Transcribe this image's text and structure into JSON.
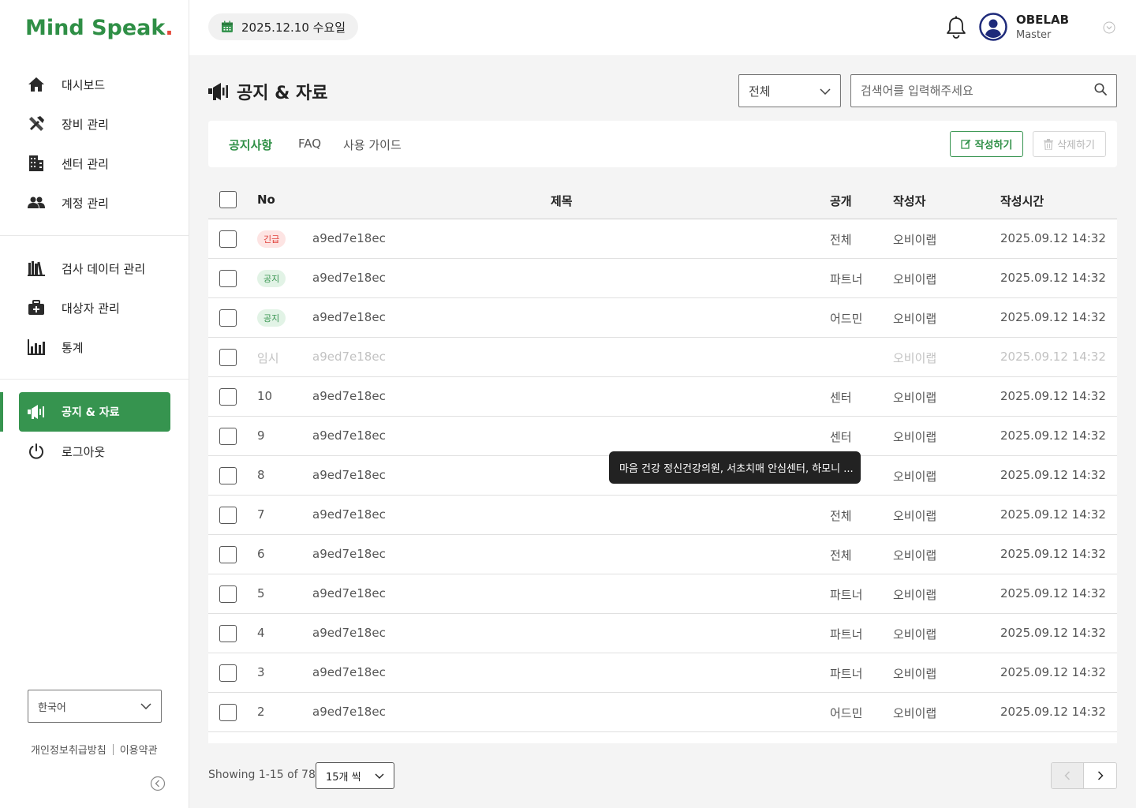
{
  "app": {
    "logo_text": "Mind Speak",
    "logo_dot": "."
  },
  "sidebar": {
    "group1": [
      {
        "label": "대시보드",
        "icon": "home-icon"
      },
      {
        "label": "장비 관리",
        "icon": "tools-icon"
      },
      {
        "label": "센터 관리",
        "icon": "building-icon"
      },
      {
        "label": "계정 관리",
        "icon": "users-icon"
      }
    ],
    "group2": [
      {
        "label": "검사 데이터 관리",
        "icon": "books-icon"
      },
      {
        "label": "대상자 관리",
        "icon": "medical-kit-icon"
      },
      {
        "label": "통계",
        "icon": "bar-chart-icon"
      }
    ],
    "group3": [
      {
        "label": "공지 & 자료",
        "icon": "megaphone-icon",
        "active": true
      },
      {
        "label": "로그아웃",
        "icon": "power-icon"
      }
    ],
    "language": "한국어",
    "footer_privacy": "개인정보취급방침",
    "footer_terms": "이용약관"
  },
  "header": {
    "date": "2025.12.10 수요일",
    "user_name": "OBELAB",
    "user_role": "Master"
  },
  "page": {
    "title": "공지 & 자료",
    "filter_value": "전체",
    "search_placeholder": "검색어를 입력해주세요",
    "tabs": [
      "공지사항",
      "FAQ",
      "사용 가이드"
    ],
    "active_tab": 0,
    "write_button": "작성하기",
    "delete_button": "삭제하기"
  },
  "table": {
    "headers": {
      "no": "No",
      "title": "제목",
      "visibility": "공개",
      "author": "작성자",
      "time": "작성시간"
    },
    "rows": [
      {
        "no": "",
        "badge": "긴급",
        "badge_type": "urgent",
        "title": "a9ed7e18ec",
        "visibility": "전체",
        "author": "오비이랩",
        "time": "2025.09.12 14:32"
      },
      {
        "no": "",
        "badge": "공지",
        "badge_type": "notice",
        "title": "a9ed7e18ec",
        "visibility": "파트너",
        "author": "오비이랩",
        "time": "2025.09.12 14:32"
      },
      {
        "no": "",
        "badge": "공지",
        "badge_type": "notice",
        "title": "a9ed7e18ec",
        "visibility": "어드민",
        "author": "오비이랩",
        "time": "2025.09.12 14:32"
      },
      {
        "no": "임시",
        "badge": "",
        "badge_type": "temp",
        "title": "a9ed7e18ec",
        "visibility": "",
        "author": "오비이랩",
        "time": "2025.09.12 14:32"
      },
      {
        "no": "10",
        "badge": "",
        "badge_type": "",
        "title": "a9ed7e18ec",
        "visibility": "센터",
        "author": "오비이랩",
        "time": "2025.09.12 14:32"
      },
      {
        "no": "9",
        "badge": "",
        "badge_type": "",
        "title": "a9ed7e18ec",
        "visibility": "센터",
        "author": "오비이랩",
        "time": "2025.09.12 14:32"
      },
      {
        "no": "8",
        "badge": "",
        "badge_type": "",
        "title": "a9ed7e18ec",
        "visibility": "",
        "author": "오비이랩",
        "time": "2025.09.12 14:32"
      },
      {
        "no": "7",
        "badge": "",
        "badge_type": "",
        "title": "a9ed7e18ec",
        "visibility": "전체",
        "author": "오비이랩",
        "time": "2025.09.12 14:32"
      },
      {
        "no": "6",
        "badge": "",
        "badge_type": "",
        "title": "a9ed7e18ec",
        "visibility": "전체",
        "author": "오비이랩",
        "time": "2025.09.12 14:32"
      },
      {
        "no": "5",
        "badge": "",
        "badge_type": "",
        "title": "a9ed7e18ec",
        "visibility": "파트너",
        "author": "오비이랩",
        "time": "2025.09.12 14:32"
      },
      {
        "no": "4",
        "badge": "",
        "badge_type": "",
        "title": "a9ed7e18ec",
        "visibility": "파트너",
        "author": "오비이랩",
        "time": "2025.09.12 14:32"
      },
      {
        "no": "3",
        "badge": "",
        "badge_type": "",
        "title": "a9ed7e18ec",
        "visibility": "파트너",
        "author": "오비이랩",
        "time": "2025.09.12 14:32"
      },
      {
        "no": "2",
        "badge": "",
        "badge_type": "",
        "title": "a9ed7e18ec",
        "visibility": "어드민",
        "author": "오비이랩",
        "time": "2025.09.12 14:32"
      }
    ],
    "tooltip": "마음 건강 정신건강의원, 서초치매 안심센터, 하모니 ..."
  },
  "pagination": {
    "showing": "Showing 1-15 of 78",
    "page_size": "15개 씩"
  },
  "colors": {
    "brand": "#36944f",
    "urgent": "#e0413b"
  }
}
